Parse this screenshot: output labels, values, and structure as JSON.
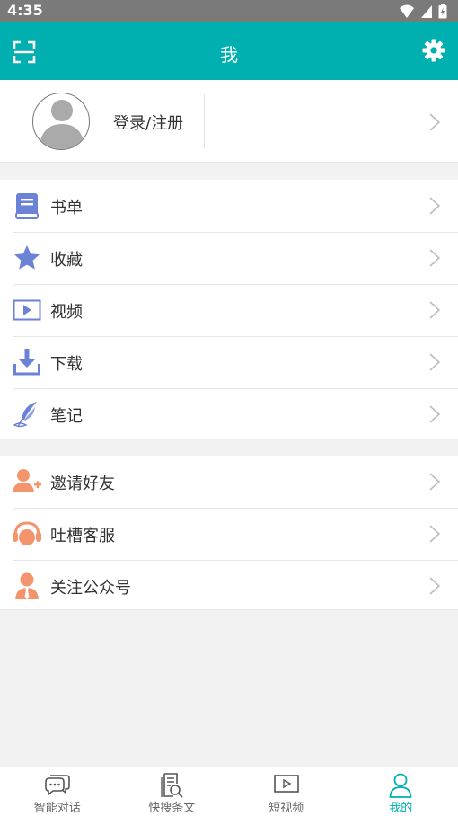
{
  "status_bar": {
    "time": "4:35"
  },
  "app_bar": {
    "title": "我"
  },
  "profile": {
    "login_label": "登录/注册"
  },
  "menu_group_1": [
    {
      "label": "书单",
      "icon": "book-icon"
    },
    {
      "label": "收藏",
      "icon": "star-icon"
    },
    {
      "label": "视频",
      "icon": "video-icon"
    },
    {
      "label": "下载",
      "icon": "download-icon"
    },
    {
      "label": "笔记",
      "icon": "feather-icon"
    }
  ],
  "menu_group_2": [
    {
      "label": "邀请好友",
      "icon": "invite-friend-icon"
    },
    {
      "label": "吐槽客服",
      "icon": "headset-icon"
    },
    {
      "label": "关注公众号",
      "icon": "person-tie-icon"
    }
  ],
  "tabs": [
    {
      "label": "智能对话",
      "icon": "chat-icon"
    },
    {
      "label": "快搜条文",
      "icon": "document-search-icon"
    },
    {
      "label": "短视频",
      "icon": "play-icon"
    },
    {
      "label": "我的",
      "icon": "person-icon",
      "active": true
    }
  ],
  "colors": {
    "accent": "#00afaf",
    "blue_icon": "#6b82d6",
    "orange_icon": "#f4946c"
  }
}
